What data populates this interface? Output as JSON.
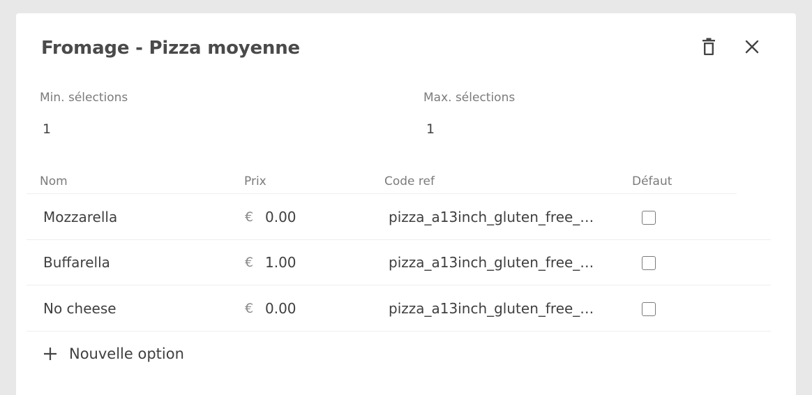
{
  "dialog": {
    "title": "Fromage - Pizza moyenne",
    "icons": {
      "delete": "trash-icon",
      "close": "close-icon"
    }
  },
  "fields": {
    "min": {
      "label": "Min. sélections",
      "value": "1"
    },
    "max": {
      "label": "Max. sélections",
      "value": "1"
    }
  },
  "table": {
    "columns": [
      "Nom",
      "Prix",
      "Code ref",
      "Défaut"
    ],
    "currency_symbol": "€",
    "rows": [
      {
        "name": "Mozzarella",
        "price": "0.00",
        "code": "pizza_a13inch_gluten_free_…",
        "default": false
      },
      {
        "name": "Buffarella",
        "price": "1.00",
        "code": "pizza_a13inch_gluten_free_…",
        "default": false
      },
      {
        "name": "No cheese",
        "price": "0.00",
        "code": "pizza_a13inch_gluten_free_…",
        "default": false
      }
    ]
  },
  "actions": {
    "add_option_label": "Nouvelle option",
    "add_icon": "plus-icon"
  }
}
